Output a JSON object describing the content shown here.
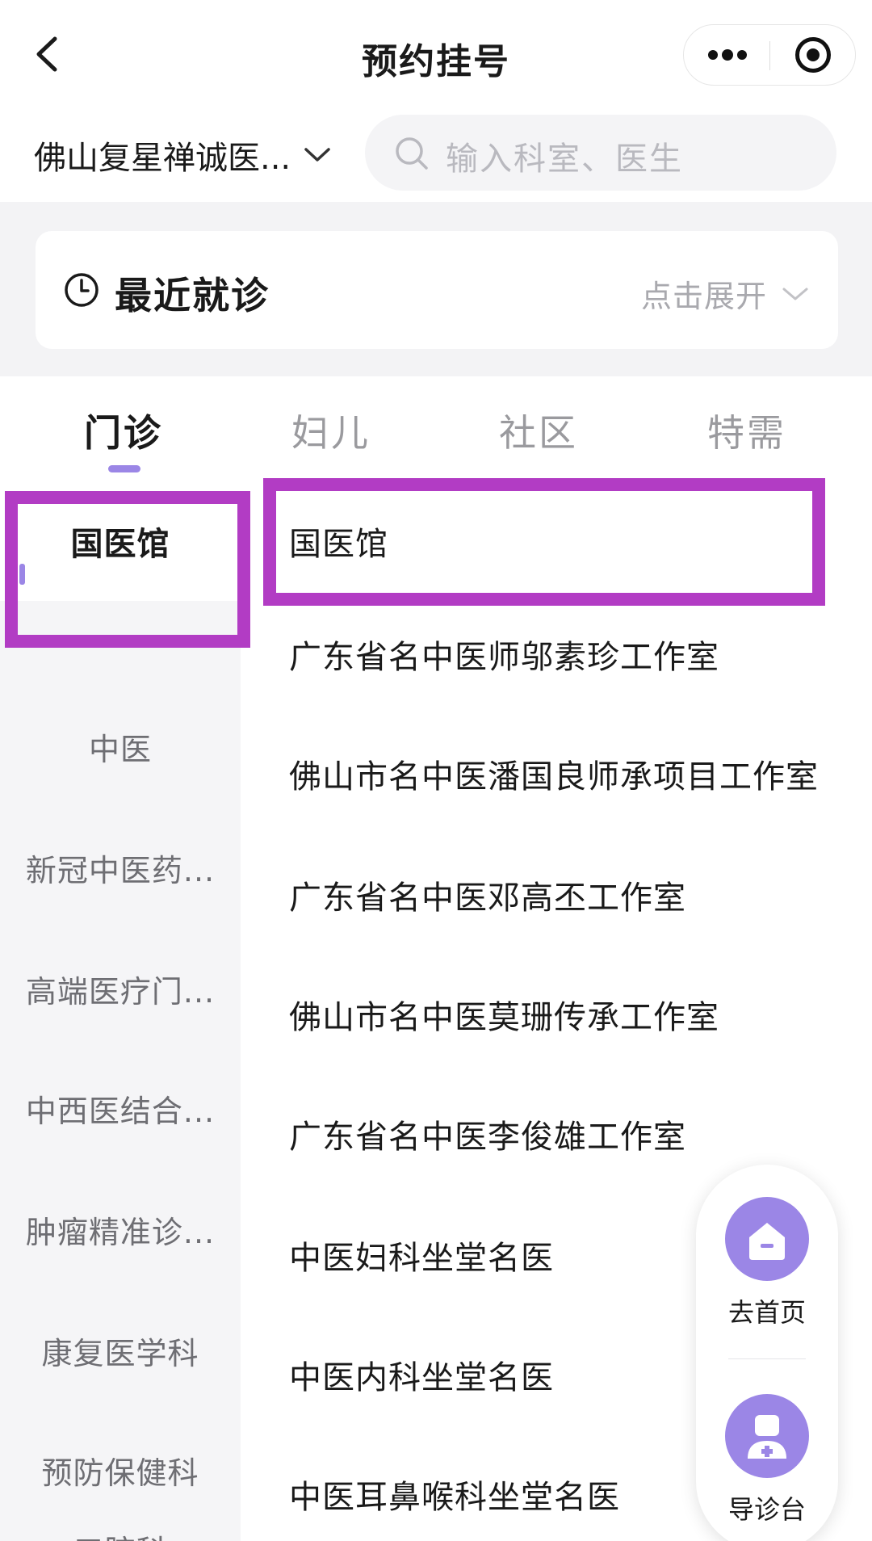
{
  "nav": {
    "title": "预约挂号"
  },
  "hospital": {
    "name": "佛山复星禅诚医..."
  },
  "search": {
    "placeholder": "输入科室、医生"
  },
  "recent": {
    "title": "最近就诊",
    "expand_label": "点击展开"
  },
  "tabs": [
    {
      "label": "门诊",
      "active": true
    },
    {
      "label": "妇儿",
      "active": false
    },
    {
      "label": "社区",
      "active": false
    },
    {
      "label": "特需",
      "active": false
    }
  ],
  "categories": [
    {
      "label": "国医馆",
      "active": true
    },
    {
      "label": "中医"
    },
    {
      "label": "新冠中医药..."
    },
    {
      "label": "高端医疗门..."
    },
    {
      "label": "中西医结合..."
    },
    {
      "label": "肿瘤精准诊..."
    },
    {
      "label": "康复医学科"
    },
    {
      "label": "预防保健科"
    },
    {
      "label": "口腔科"
    }
  ],
  "departments": [
    {
      "label": "国医馆"
    },
    {
      "label": "广东省名中医师邬素珍工作室"
    },
    {
      "label": "佛山市名中医潘国良师承项目工作室"
    },
    {
      "label": "广东省名中医邓高丕工作室"
    },
    {
      "label": "佛山市名中医莫珊传承工作室"
    },
    {
      "label": "广东省名中医李俊雄工作室"
    },
    {
      "label": "中医妇科坐堂名医"
    },
    {
      "label": "中医内科坐堂名医"
    },
    {
      "label": "中医耳鼻喉科坐堂名医"
    }
  ],
  "float_actions": {
    "home_label": "去首页",
    "guide_label": "导诊台"
  },
  "colors": {
    "accent": "#9b86e6",
    "highlight": "#b23cc4",
    "panel_gray": "#f5f5f7"
  },
  "icons": [
    "back-arrow-icon",
    "more-dots-icon",
    "mini-program-close-icon",
    "chevron-down-icon",
    "search-icon",
    "clock-icon",
    "home-icon",
    "nurse-icon"
  ]
}
